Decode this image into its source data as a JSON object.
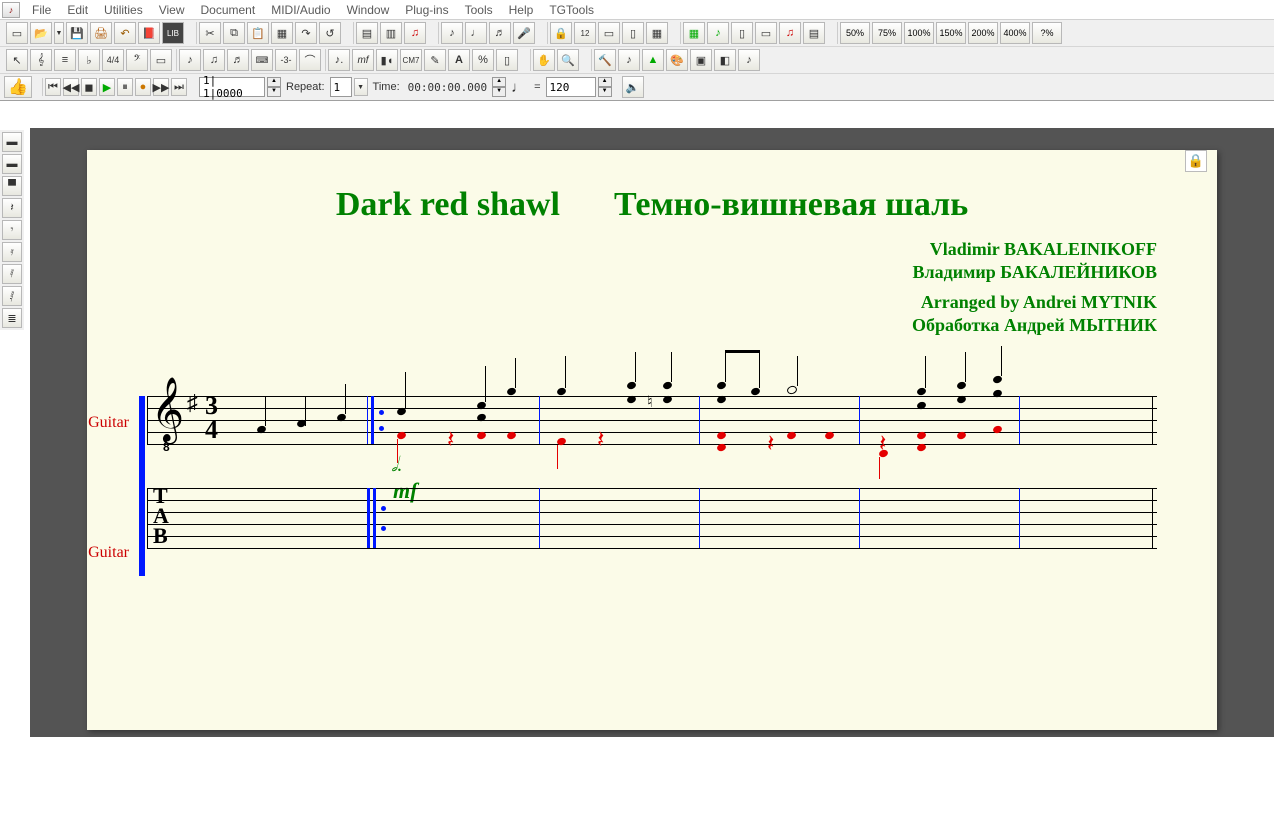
{
  "menu": {
    "items": [
      "File",
      "Edit",
      "Utilities",
      "View",
      "Document",
      "MIDI/Audio",
      "Window",
      "Plug-ins",
      "Tools",
      "Help",
      "TGTools"
    ]
  },
  "zoom": {
    "levels": [
      "50%",
      "75%",
      "100%",
      "150%",
      "200%",
      "400%",
      "?%"
    ]
  },
  "transport": {
    "position": "1| 1|0000",
    "repeat_label": "Repeat:",
    "repeat_value": "1",
    "time_label": "Time:",
    "time_value": "00:00:00.000",
    "tempo_note": "♩",
    "tempo_equals": "=",
    "tempo_value": "120"
  },
  "score": {
    "title_en": "Dark red shawl",
    "title_ru": "Темно-вишневая шаль",
    "composer_en": "Vladimir BAKALEINIKOFF",
    "composer_ru": "Владимир БАКАЛЕЙНИКОВ",
    "arranger_en": "Arranged by Andrei MYTNIK",
    "arranger_ru": "Обработка Андрей МЫТНИК",
    "staff1_label": "Guitar",
    "staff2_label": "Guitar",
    "time_num": "3",
    "time_den": "4",
    "dynamic": "mf",
    "tab_letters": [
      "T",
      "A",
      "B"
    ]
  }
}
